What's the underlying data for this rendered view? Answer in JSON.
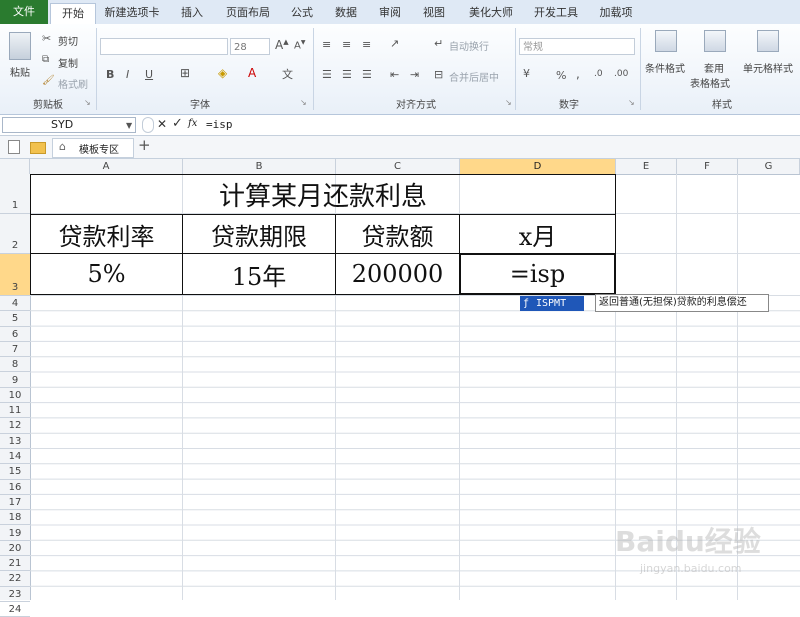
{
  "ribbon_tabs": [
    "文件",
    "开始",
    "新建选项卡",
    "插入",
    "页面布局",
    "公式",
    "数据",
    "审阅",
    "视图",
    "美化大师",
    "开发工具",
    "加载项"
  ],
  "active_tab": "开始",
  "clipboard": {
    "paste": "粘贴",
    "cut": "剪切",
    "copy": "复制",
    "format_painter": "格式刷",
    "group": "剪贴板"
  },
  "font": {
    "name": "",
    "size": "28",
    "group": "字体",
    "bold": "B",
    "italic": "I",
    "underline": "U"
  },
  "alignment": {
    "wrap": "自动换行",
    "merge": "合并后居中",
    "group": "对齐方式"
  },
  "number": {
    "format": "常规",
    "percent": "%",
    "comma": ",",
    "group": "数字"
  },
  "styles": {
    "conditional": "条件格式",
    "table": "套用表格格式",
    "table_line1": "套用",
    "table_line2": "表格格式",
    "cell_styles": "单元格样式",
    "group": "样式"
  },
  "formula_bar": {
    "name_box": "SYD",
    "fx": "fx",
    "content": "=isp"
  },
  "workbook_bar": {
    "template_tab": "模板专区",
    "add": "+"
  },
  "columns": [
    "A",
    "B",
    "C",
    "D",
    "E",
    "F",
    "G"
  ],
  "selected_column": "D",
  "rows": [
    "1",
    "2",
    "3",
    "4",
    "5",
    "6",
    "7",
    "8",
    "9",
    "10",
    "11",
    "12",
    "13",
    "14",
    "15",
    "16",
    "17",
    "18",
    "19",
    "20",
    "21",
    "22",
    "23",
    "24"
  ],
  "selected_row": "3",
  "sheet": {
    "title": "计算某月还款利息",
    "headers": [
      "贷款利率",
      "贷款期限",
      "贷款额",
      "x月"
    ],
    "values": [
      "5%",
      "15年",
      "200000",
      "=isp"
    ]
  },
  "autocomplete": {
    "function": "ISPMT",
    "tooltip": "返回普通(无担保)贷款的利息偿还"
  },
  "watermark": {
    "logo": "Baidu经验",
    "url": "jingyan.baidu.com"
  }
}
